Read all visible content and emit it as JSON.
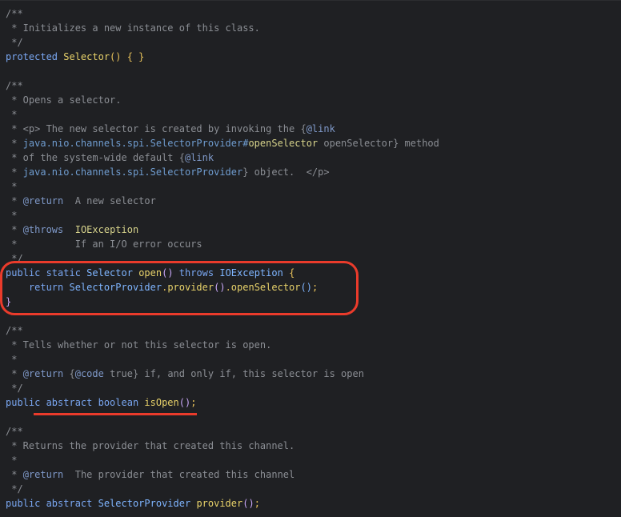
{
  "code_lines": [
    {
      "segments": [
        {
          "text": "/**",
          "cls": "c"
        }
      ]
    },
    {
      "segments": [
        {
          "text": " * Initializes a new instance of this class.",
          "cls": "c"
        }
      ]
    },
    {
      "segments": [
        {
          "text": " */",
          "cls": "c"
        }
      ]
    },
    {
      "segments": [
        {
          "text": "protected ",
          "cls": "k"
        },
        {
          "text": "Selector",
          "cls": "f"
        },
        {
          "text": "() { }",
          "cls": "p"
        }
      ]
    },
    {
      "segments": []
    },
    {
      "segments": [
        {
          "text": "/**",
          "cls": "c"
        }
      ]
    },
    {
      "segments": [
        {
          "text": " * Opens a selector.",
          "cls": "c"
        }
      ]
    },
    {
      "segments": [
        {
          "text": " *",
          "cls": "c"
        }
      ]
    },
    {
      "segments": [
        {
          "text": " * <p> The new selector is created by invoking the {",
          "cls": "c"
        },
        {
          "text": "@link",
          "cls": "ct"
        }
      ]
    },
    {
      "segments": [
        {
          "text": " * ",
          "cls": "c"
        },
        {
          "text": "java.nio.channels.spi.SelectorProvider#",
          "cls": "cl"
        },
        {
          "text": "openSelector",
          "cls": "cm"
        },
        {
          "text": " openSelector} method",
          "cls": "c"
        }
      ]
    },
    {
      "segments": [
        {
          "text": " * of the system-wide default {",
          "cls": "c"
        },
        {
          "text": "@link",
          "cls": "ct"
        }
      ]
    },
    {
      "segments": [
        {
          "text": " * ",
          "cls": "c"
        },
        {
          "text": "java.nio.channels.spi.SelectorProvider",
          "cls": "cl"
        },
        {
          "text": "} object.  </p>",
          "cls": "c"
        }
      ]
    },
    {
      "segments": [
        {
          "text": " *",
          "cls": "c"
        }
      ]
    },
    {
      "segments": [
        {
          "text": " * ",
          "cls": "c"
        },
        {
          "text": "@return",
          "cls": "ct"
        },
        {
          "text": "  A new selector",
          "cls": "c"
        }
      ]
    },
    {
      "segments": [
        {
          "text": " *",
          "cls": "c"
        }
      ]
    },
    {
      "segments": [
        {
          "text": " * ",
          "cls": "c"
        },
        {
          "text": "@throws",
          "cls": "ct"
        },
        {
          "text": "  ",
          "cls": "c"
        },
        {
          "text": "IOException",
          "cls": "cm"
        }
      ]
    },
    {
      "segments": [
        {
          "text": " *          If an I/O error occurs",
          "cls": "c"
        }
      ]
    },
    {
      "segments": [
        {
          "text": " */",
          "cls": "c"
        }
      ]
    },
    {
      "segments": [
        {
          "text": "public ",
          "cls": "k"
        },
        {
          "text": "static ",
          "cls": "k"
        },
        {
          "text": "Selector ",
          "cls": "t"
        },
        {
          "text": "open",
          "cls": "f"
        },
        {
          "text": "() ",
          "cls": "pp"
        },
        {
          "text": "throws ",
          "cls": "k"
        },
        {
          "text": "IOException ",
          "cls": "t"
        },
        {
          "text": "{",
          "cls": "p"
        }
      ]
    },
    {
      "segments": [
        {
          "text": "    return ",
          "cls": "k"
        },
        {
          "text": "SelectorProvider",
          "cls": "t"
        },
        {
          "text": ".",
          "cls": "p"
        },
        {
          "text": "provider",
          "cls": "f"
        },
        {
          "text": "()",
          "cls": "pp"
        },
        {
          "text": ".",
          "cls": "p"
        },
        {
          "text": "openSelector",
          "cls": "f"
        },
        {
          "text": "()",
          "cls": "t"
        },
        {
          "text": ";",
          "cls": "p"
        }
      ]
    },
    {
      "segments": [
        {
          "text": "}",
          "cls": "pp"
        }
      ]
    },
    {
      "segments": []
    },
    {
      "segments": [
        {
          "text": "/**",
          "cls": "c"
        }
      ]
    },
    {
      "segments": [
        {
          "text": " * Tells whether or not this selector is open.",
          "cls": "c"
        }
      ]
    },
    {
      "segments": [
        {
          "text": " *",
          "cls": "c"
        }
      ]
    },
    {
      "segments": [
        {
          "text": " * ",
          "cls": "c"
        },
        {
          "text": "@return",
          "cls": "ct"
        },
        {
          "text": " {",
          "cls": "c"
        },
        {
          "text": "@code",
          "cls": "ct"
        },
        {
          "text": " true} if, and only if, this selector is open",
          "cls": "c"
        }
      ]
    },
    {
      "segments": [
        {
          "text": " */",
          "cls": "c"
        }
      ]
    },
    {
      "segments": [
        {
          "text": "public ",
          "cls": "k"
        },
        {
          "text": "abstract ",
          "cls": "k"
        },
        {
          "text": "boolean ",
          "cls": "k"
        },
        {
          "text": "isOpen",
          "cls": "f"
        },
        {
          "text": "()",
          "cls": "pp"
        },
        {
          "text": ";",
          "cls": "p"
        }
      ]
    },
    {
      "segments": []
    },
    {
      "segments": [
        {
          "text": "/**",
          "cls": "c"
        }
      ]
    },
    {
      "segments": [
        {
          "text": " * Returns the provider that created this channel.",
          "cls": "c"
        }
      ]
    },
    {
      "segments": [
        {
          "text": " *",
          "cls": "c"
        }
      ]
    },
    {
      "segments": [
        {
          "text": " * ",
          "cls": "c"
        },
        {
          "text": "@return",
          "cls": "ct"
        },
        {
          "text": "  The provider that created this channel",
          "cls": "c"
        }
      ]
    },
    {
      "segments": [
        {
          "text": " */",
          "cls": "c"
        }
      ]
    },
    {
      "segments": [
        {
          "text": "public ",
          "cls": "k"
        },
        {
          "text": "abstract ",
          "cls": "k"
        },
        {
          "text": "SelectorProvider ",
          "cls": "t"
        },
        {
          "text": "provider",
          "cls": "f"
        },
        {
          "text": "()",
          "cls": "pp"
        },
        {
          "text": ";",
          "cls": "p"
        }
      ]
    }
  ],
  "annotations": {
    "highlight_box_color": "#ea3b2b",
    "underline_color": "#ea3b2b"
  }
}
